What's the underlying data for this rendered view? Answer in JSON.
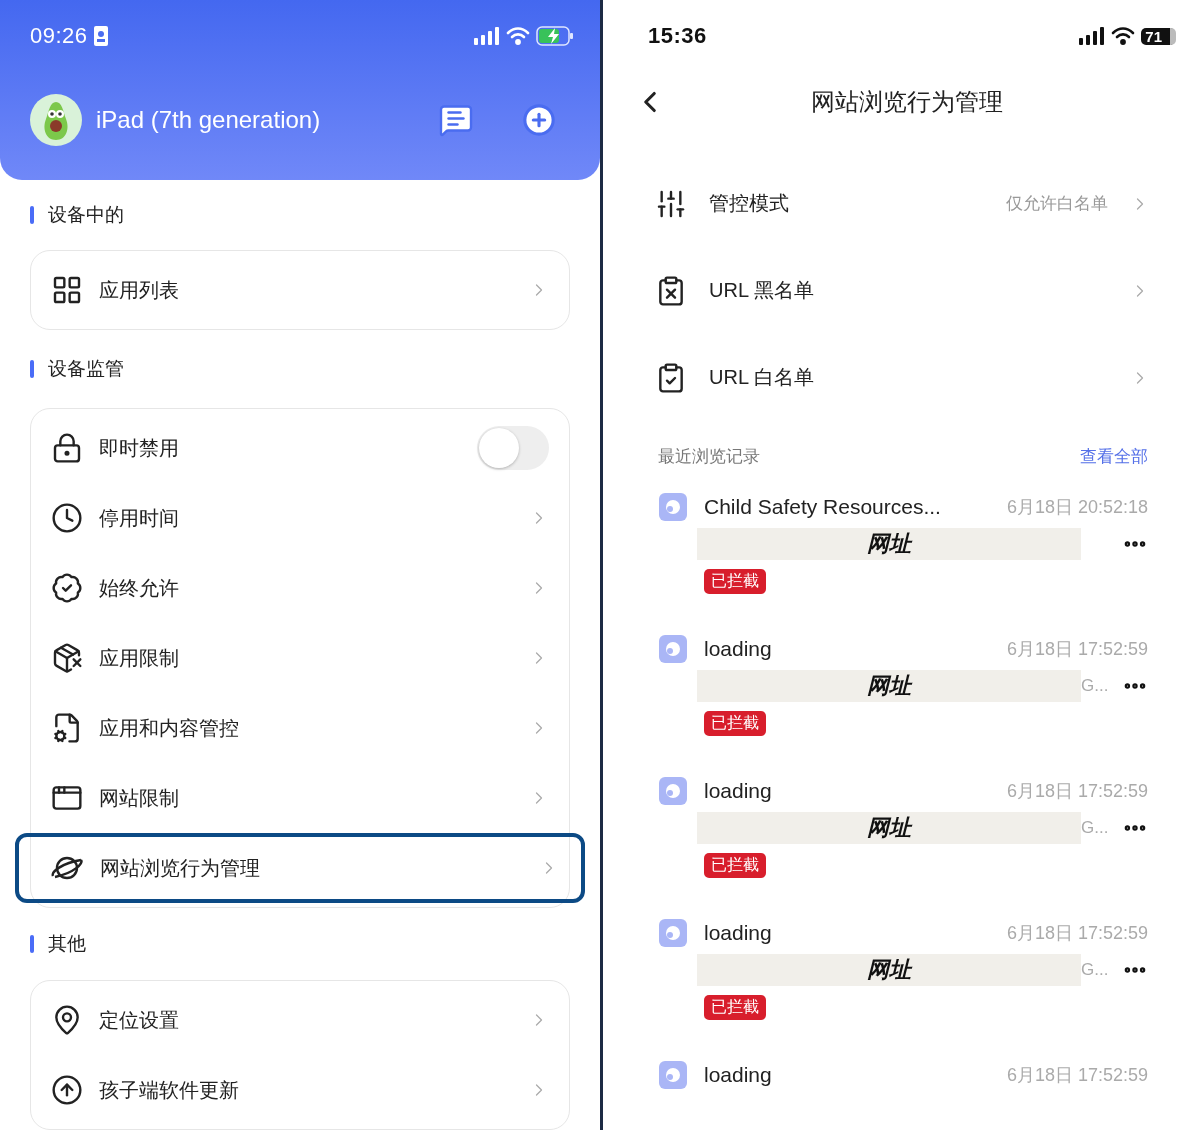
{
  "left_screen": {
    "status_bar": {
      "time": "09:26"
    },
    "device": {
      "name": "iPad (7th generation)"
    },
    "sections": [
      {
        "title": "设备中的",
        "items": [
          {
            "kind": "link",
            "label": "应用列表",
            "highlighted": false
          }
        ]
      },
      {
        "title": "设备监管",
        "items": [
          {
            "kind": "toggle",
            "label": "即时禁用",
            "on": false,
            "highlighted": false
          },
          {
            "kind": "link",
            "label": "停用时间",
            "highlighted": false
          },
          {
            "kind": "link",
            "label": "始终允许",
            "highlighted": false
          },
          {
            "kind": "link",
            "label": "应用限制",
            "highlighted": false
          },
          {
            "kind": "link",
            "label": "应用和内容管控",
            "highlighted": false
          },
          {
            "kind": "link",
            "label": "网站限制",
            "highlighted": false
          },
          {
            "kind": "link",
            "label": "网站浏览行为管理",
            "highlighted": true
          }
        ]
      },
      {
        "title": "其他",
        "items": [
          {
            "kind": "link",
            "label": "定位设置",
            "highlighted": false
          },
          {
            "kind": "link",
            "label": "孩子端软件更新",
            "highlighted": false
          }
        ]
      }
    ]
  },
  "right_screen": {
    "status_bar": {
      "time": "15:36",
      "battery": "71"
    },
    "nav": {
      "title": "网站浏览行为管理"
    },
    "settings": [
      {
        "label": "管控模式",
        "value": "仅允许白名单"
      },
      {
        "label": "URL 黑名单"
      },
      {
        "label": "URL 白名单"
      }
    ],
    "history": {
      "title": "最近浏览记录",
      "link": "查看全部",
      "records": [
        {
          "title": "Child Safety Resources...",
          "time": "6月18日 20:52:18",
          "url": "网址",
          "tag": "已拦截"
        },
        {
          "title": "loading",
          "time": "6月18日 17:52:59",
          "url": "网址",
          "domain": "G...",
          "tag": "已拦截"
        },
        {
          "title": "loading",
          "time": "6月18日 17:52:59",
          "url": "网址",
          "domain": "G...",
          "tag": "已拦截"
        },
        {
          "title": "loading",
          "time": "6月18日 17:52:59",
          "url": "网址",
          "domain": "G...",
          "tag": "已拦截"
        },
        {
          "title": "loading",
          "time": "6月18日 17:52:59"
        }
      ]
    }
  }
}
